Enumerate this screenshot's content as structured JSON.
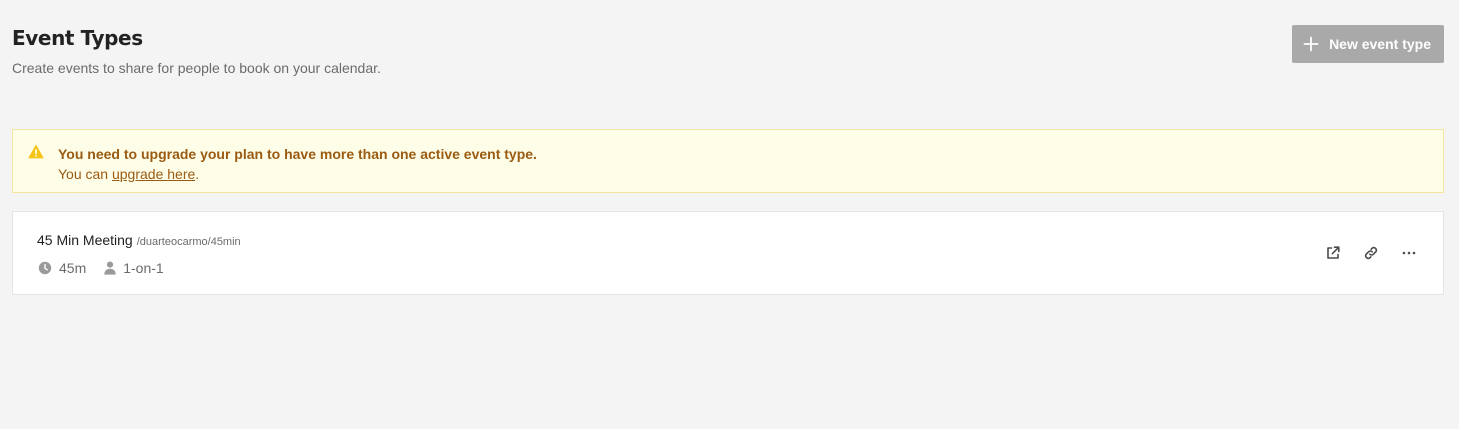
{
  "header": {
    "title": "Event Types",
    "subtitle": "Create events to share for people to book on your calendar.",
    "new_button_label": "New event type"
  },
  "alert": {
    "message": "You need to upgrade your plan to have more than one active event type.",
    "prefix": "You can ",
    "link_label": "upgrade here",
    "suffix": "."
  },
  "event_types": [
    {
      "title": "45 Min Meeting",
      "slug": "/duarteocarmo/45min",
      "duration": "45m",
      "type": "1-on-1"
    }
  ],
  "icons": {
    "new_button": "plus-icon",
    "alert": "warning-icon",
    "duration": "clock-icon",
    "type": "user-icon",
    "actions": [
      "external-link-icon",
      "link-icon",
      "more-horizontal-icon"
    ]
  },
  "colors": {
    "background": "#f4f4f4",
    "button_disabled": "#a9a9a9",
    "alert_background": "#fefde7",
    "alert_text": "#9a5b12",
    "warning_icon": "#f5c518"
  }
}
